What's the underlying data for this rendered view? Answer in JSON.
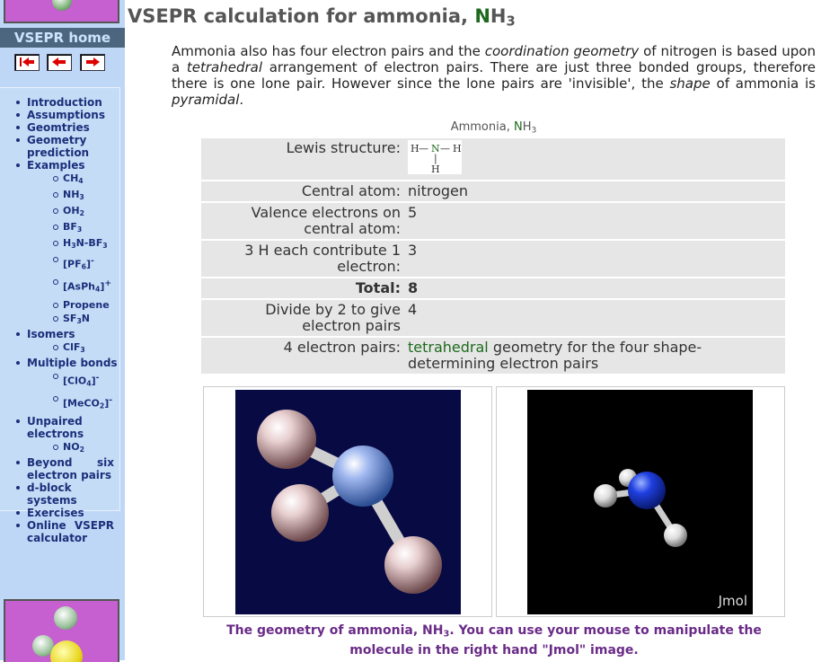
{
  "sidebar": {
    "home_label": "VSEPR home",
    "toc": [
      {
        "label": "Introduction"
      },
      {
        "label": "Assumptions"
      },
      {
        "label": "Geomtries"
      },
      {
        "label": "Geometry prediction"
      },
      {
        "label": "Examples",
        "children": [
          "CH4",
          "NH3",
          "OH2",
          "BF3",
          "H3N-BF3",
          "[PF6]⁻",
          "[AsPh4]⁺",
          "Propene",
          "SF3N"
        ]
      },
      {
        "label": "Isomers",
        "children": [
          "ClF3"
        ]
      },
      {
        "label": "Multiple bonds",
        "children": [
          "[ClO4]⁻",
          "[MeCO2]⁻"
        ]
      },
      {
        "label": "Unpaired electrons",
        "children": [
          "NO2"
        ]
      },
      {
        "label": "Beyond six electron pairs"
      },
      {
        "label": "d-block systems"
      },
      {
        "label": "Exercises"
      },
      {
        "label": "Online VSEPR calculator"
      }
    ]
  },
  "page": {
    "title_text": "VSEPR calculation for ammonia, ",
    "title_n": "N",
    "title_h": "H",
    "title_3": "3",
    "intro": {
      "p1": "Ammonia also has four electron pairs and the ",
      "e1": "coordination geometry",
      "p2": " of nitrogen is based upon a ",
      "e2": "tetrahedral",
      "p3": " arrangement of electron pairs. There are just three bonded groups, therefore there is one lone pair. However since the lone pairs are 'invisible', the ",
      "e3": "shape",
      "p4": " of ammonia is ",
      "e4": "pyramidal",
      "p5": "."
    },
    "table_caption": {
      "pre": "Ammonia, ",
      "n": "N",
      "h": "H",
      "three": "3"
    }
  },
  "table": {
    "lewis_label": "Lewis structure:",
    "central_label": "Central atom:",
    "central_value": "nitrogen",
    "valence_label": "Valence electrons on central atom:",
    "valence_value": "5",
    "h_label": "3 H each contribute 1 electron:",
    "h_value": "3",
    "total_label": "Total:",
    "total_value": "8",
    "divide_label": "Divide by 2 to give electron pairs",
    "divide_value": "4",
    "pairs_label": "4 electron pairs:",
    "pairs_value_green": "tetrahedral",
    "pairs_value_rest": " geometry for the four shape-determining electron pairs"
  },
  "lewis": {
    "h": "H",
    "n": "N",
    "dash": "—",
    "vbar": "|"
  },
  "images": {
    "jmol_label": "Jmol"
  },
  "caption": {
    "text1": "The geometry of ammonia, NH",
    "sub": "3",
    "text2": ". You can use your mouse to manipulate the molecule in the right hand \"Jmol\" image."
  },
  "colors": {
    "sidebar": "#bfd7f6",
    "home_bar": "#4d6680",
    "nitrogen_green": "#1d6a1d",
    "caption_purple": "#6a2b88"
  }
}
